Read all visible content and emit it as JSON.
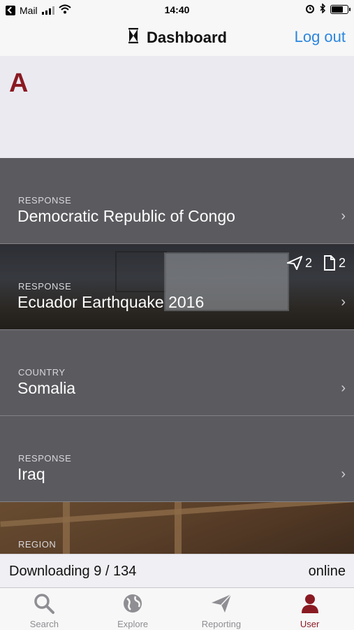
{
  "status_bar": {
    "back_app": "Mail",
    "time": "14:40"
  },
  "nav": {
    "title": "Dashboard",
    "logout_label": "Log out"
  },
  "banner": {
    "logo_text": "A"
  },
  "rows": [
    {
      "kind": "RESPONSE",
      "name": "Democratic Republic of Congo"
    },
    {
      "kind": "RESPONSE",
      "name": "Ecuador Earthquake 2016",
      "sent_count": "2",
      "doc_count": "2"
    },
    {
      "kind": "COUNTRY",
      "name": "Somalia"
    },
    {
      "kind": "RESPONSE",
      "name": "Iraq"
    },
    {
      "kind": "REGION",
      "name": ""
    }
  ],
  "download_bar": {
    "progress_text": "Downloading 9 / 134",
    "connection": "online"
  },
  "tabs": [
    {
      "label": "Search",
      "icon": "search-icon"
    },
    {
      "label": "Explore",
      "icon": "globe-icon"
    },
    {
      "label": "Reporting",
      "icon": "paper-plane-icon"
    },
    {
      "label": "User",
      "icon": "user-icon"
    }
  ],
  "colors": {
    "accent": "#8a1a22",
    "link": "#2b86e0",
    "row_bg": "#5b5a5f"
  }
}
